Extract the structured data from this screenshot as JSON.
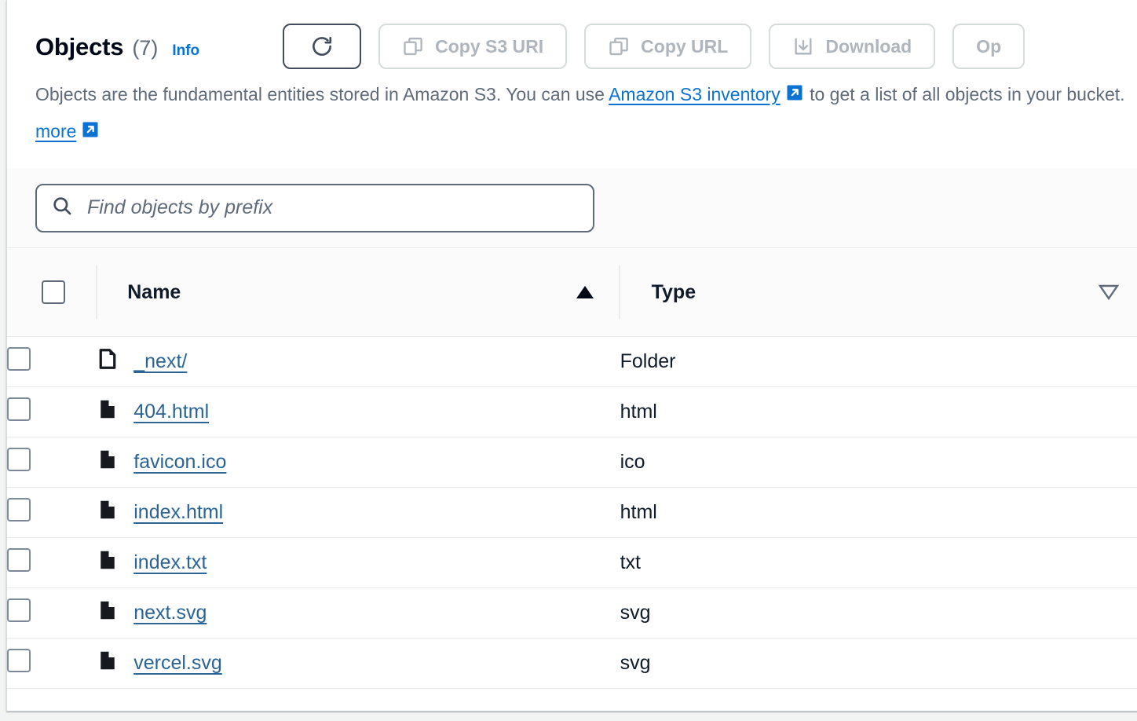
{
  "panel": {
    "title": "Objects",
    "count": "(7)",
    "info_label": "Info",
    "description_part1": "Objects are the fundamental entities stored in Amazon S3. You can use ",
    "description_link": "Amazon S3 inventory",
    "description_part2": " to get a list of all objects in your bucket. ",
    "description_link2": "more"
  },
  "toolbar": {
    "refresh_label": "",
    "refresh_icon": "refresh-icon",
    "buttons": [
      {
        "label": "Copy S3 URI",
        "icon": "copy-icon",
        "disabled": true
      },
      {
        "label": "Copy URL",
        "icon": "copy-icon",
        "disabled": true
      },
      {
        "label": "Download",
        "icon": "download-icon",
        "disabled": true
      },
      {
        "label": "Op",
        "icon": "none",
        "disabled": true
      }
    ]
  },
  "search": {
    "placeholder": "Find objects by prefix",
    "value": "",
    "icon": "search-icon"
  },
  "table": {
    "columns": [
      {
        "label": "Name",
        "sort": "ascending",
        "sort_icon": "triangle-up-filled"
      },
      {
        "label": "Type",
        "sort": "none",
        "sort_icon": "triangle-down-outline"
      }
    ],
    "rows": [
      {
        "name": "_next/",
        "type": "Folder",
        "icon": "folder-icon"
      },
      {
        "name": "404.html",
        "type": "html",
        "icon": "file-icon"
      },
      {
        "name": "favicon.ico",
        "type": "ico",
        "icon": "file-icon"
      },
      {
        "name": "index.html",
        "type": "html",
        "icon": "file-icon"
      },
      {
        "name": "index.txt",
        "type": "txt",
        "icon": "file-icon"
      },
      {
        "name": "next.svg",
        "type": "svg",
        "icon": "file-icon"
      },
      {
        "name": "vercel.svg",
        "type": "svg",
        "icon": "file-icon"
      }
    ]
  },
  "colors": {
    "link": "#0972d3",
    "name_link": "#2a6496",
    "text": "#0f1b2a",
    "muted": "#5f6b7a",
    "disabled": "#aeb5bd",
    "border": "#e9ebed",
    "header_bg": "#fbfbfb"
  }
}
